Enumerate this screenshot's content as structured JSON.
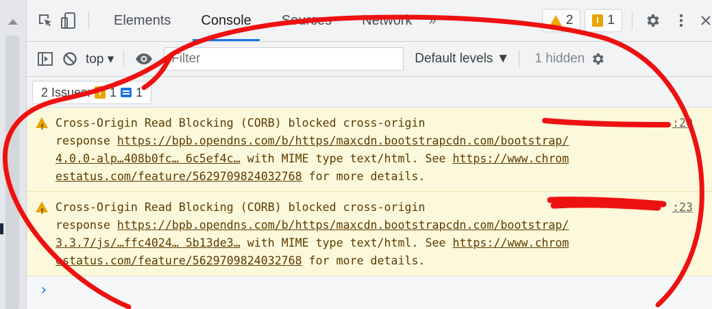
{
  "tabs": [
    {
      "label": "Elements",
      "active": false
    },
    {
      "label": "Console",
      "active": true
    },
    {
      "label": "Sources",
      "active": false
    },
    {
      "label": "Network",
      "active": false
    }
  ],
  "more_tabs": "»",
  "counters": {
    "warnings": "2",
    "issues": "1"
  },
  "toolbar": {
    "context": "top ▾",
    "filter_placeholder": "Filter",
    "levels": "Default levels ▼",
    "hidden": "1 hidden"
  },
  "issues_bar": {
    "label": "2 Issues:",
    "warning_count": "1",
    "info_count": "1"
  },
  "messages": [
    {
      "lines": [
        "Cross-Origin Read Blocking (CORB) blocked cross-origin",
        "response ",
        " with MIME type text/html. See ",
        " for more details."
      ],
      "url1_a": "https://bpb.opendns.com/b/https/maxcdn.bootstrapcdn.com/bootstrap/",
      "url1_b": "4.0.0-alp…408b0fc… 6c5ef4c…",
      "url2_a": "https://www.chrom",
      "url2_b": "estatus.com/feature/5629709824032768",
      "source": ":20"
    },
    {
      "lines": [
        "Cross-Origin Read Blocking (CORB) blocked cross-origin",
        "response ",
        " with MIME type text/html. See ",
        " for more details."
      ],
      "url1_a": "https://bpb.opendns.com/b/https/maxcdn.bootstrapcdn.com/bootstrap/",
      "url1_b": "3.3.7/js/…ffc4024… 5b13de3…",
      "url2_a": "https://www.chrom",
      "url2_b": "estatus.com/feature/5629709824032768",
      "source": ":23"
    }
  ],
  "prompt": "›",
  "colors": {
    "annotation": "#ee1111",
    "warning_bg": "#fcf8dc",
    "accent": "#1a73e8"
  }
}
